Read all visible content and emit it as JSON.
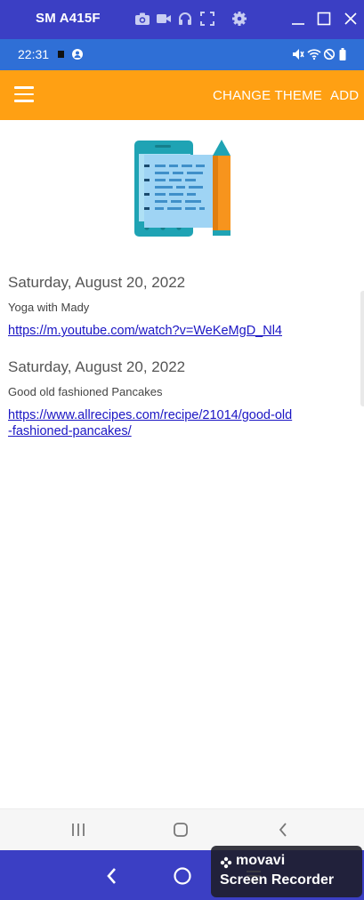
{
  "window": {
    "title": "SM A415F",
    "icons": [
      "camera-icon",
      "video-icon",
      "headphones-icon",
      "fullscreen-icon",
      "gear-icon",
      "minimize-icon",
      "maximize-icon",
      "close-icon"
    ]
  },
  "status_bar": {
    "time": "22:31",
    "icons": [
      "notification-square-icon",
      "account-icon",
      "mute-icon",
      "wifi-icon",
      "dnd-icon",
      "battery-icon"
    ]
  },
  "toolbar": {
    "change_theme_label": "CHANGE THEME",
    "add_label": "ADD",
    "accent_color": "#ffa013"
  },
  "entries": [
    {
      "date": "Saturday, August 20, 2022",
      "description": "Yoga with Mady",
      "link": "https://m.youtube.com/watch?v=WeKeMgD_Nl4"
    },
    {
      "date": "Saturday, August 20, 2022",
      "description": "Good old fashioned Pancakes",
      "link_line1": "https://www.allrecipes.com/recipe/21014/good-old",
      "link_line2": "-fashioned-pancakes/"
    }
  ],
  "watermark": {
    "brand": "movavi",
    "product": "Screen Recorder"
  }
}
